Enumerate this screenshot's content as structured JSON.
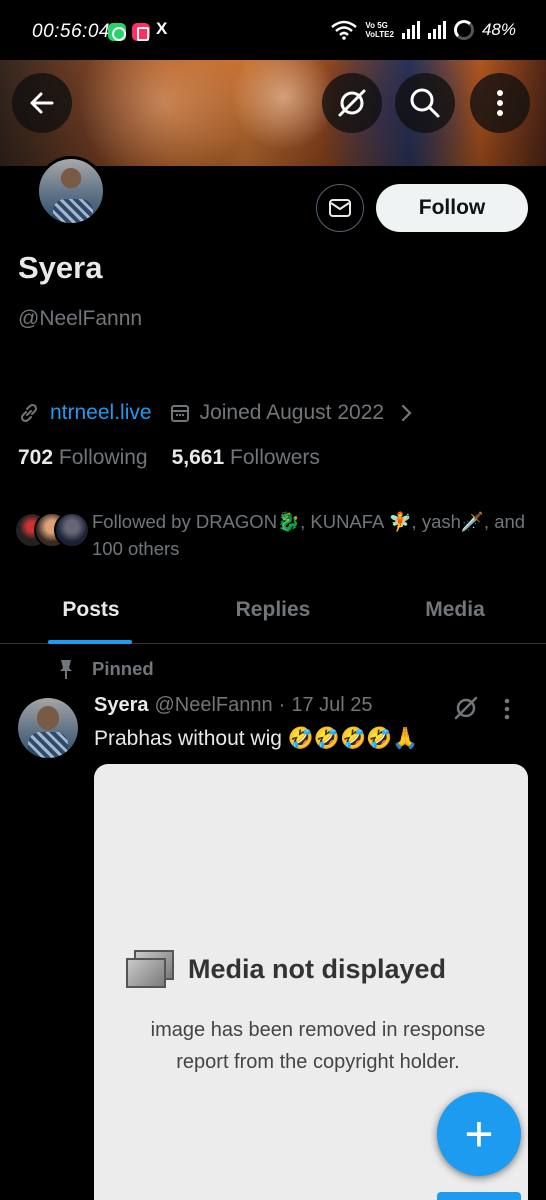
{
  "status_bar": {
    "time": "00:56:04",
    "volte_top": "Vo 5G",
    "volte_bottom": "VoLTE2",
    "battery": "48%",
    "x_glyph": "X"
  },
  "profile": {
    "display_name": "Syera",
    "handle": "@NeelFannn",
    "website": "ntrneel.live",
    "joined": "Joined August 2022",
    "following_count": "702",
    "following_label": "Following",
    "followers_count": "5,661",
    "followers_label": "Followers",
    "followed_by": "Followed by DRAGON🐉, KUNAFA 🧚, yash🗡️, and 100 others",
    "follow_label": "Follow"
  },
  "tabs": [
    {
      "label": "Posts"
    },
    {
      "label": "Replies"
    },
    {
      "label": "Media"
    }
  ],
  "pinned_tweet": {
    "pinned_label": "Pinned",
    "author": "Syera",
    "handle": "@NeelFannn",
    "separator": "·",
    "date": "17 Jul 25",
    "text": "Prabhas without wig 🤣🤣🤣🤣🙏",
    "media_title": "Media not displayed",
    "media_line1": "image has been removed in response",
    "media_line2": "report from the copyright holder."
  },
  "fab": {
    "label": "+"
  },
  "colors": {
    "accent": "#1d9bf0",
    "background": "#000000",
    "muted": "#71767b",
    "text": "#e7e9ea"
  },
  "icons": [
    "back-arrow-icon",
    "grok-icon",
    "search-icon",
    "more-vertical-icon",
    "mail-icon",
    "link-icon",
    "calendar-icon",
    "chevron-right-icon",
    "pin-icon"
  ]
}
